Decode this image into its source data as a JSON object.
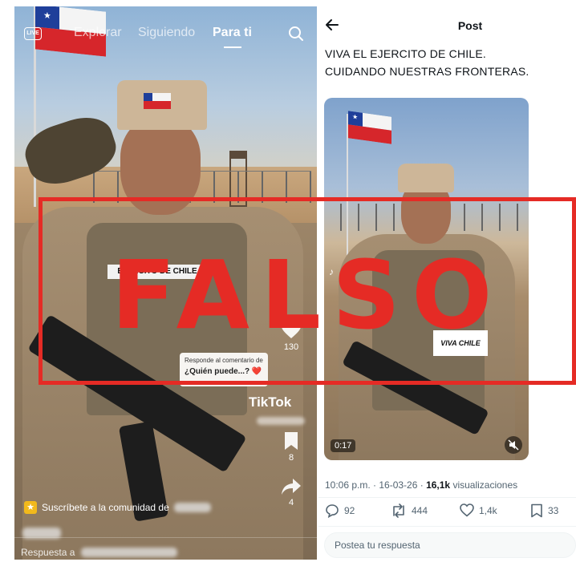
{
  "tiktok": {
    "live_label": "LIVE",
    "tabs": [
      {
        "label": "Explorar"
      },
      {
        "label": "Siguiendo"
      },
      {
        "label": "Para ti"
      }
    ],
    "patch_text": "EJERCITO DE CHILE",
    "likes_count": "130",
    "bookmark_count": "8",
    "share_count": "4",
    "sticker_small": "Responde al comentario de",
    "sticker_big": "¿Quién puede...? ❤️",
    "logo": "TikTok",
    "community_text": "Suscríbete a la comunidad de",
    "reply_text": "Respuesta a"
  },
  "xpost": {
    "title": "Post",
    "text_line1": "VIVA EL EJERCITO DE CHILE.",
    "text_line2": "CUIDANDO NUESTRAS FRONTERAS.",
    "video_sticker": "VIVA CHILE",
    "video_time": "0:17",
    "meta_time": "10:06 p.m. · 16-03-26 · ",
    "meta_views_count": "16,1k",
    "meta_views_label": " visualizaciones",
    "replies": "92",
    "reposts": "444",
    "likes": "1,4k",
    "bookmarks": "33",
    "reply_placeholder": "Postea tu respuesta"
  },
  "stamp": {
    "text": "FALSO",
    "color": "#e52b25"
  },
  "colors": {
    "stamp_red": "#e52b25",
    "chile_blue": "#1f3f9a",
    "chile_red": "#d6262b",
    "x_text": "#0f1419",
    "x_muted": "#536471"
  }
}
